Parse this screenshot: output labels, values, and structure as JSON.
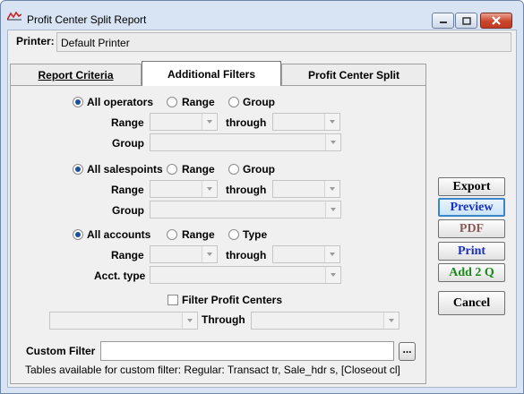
{
  "window": {
    "title": "Profit Center Split Report",
    "icon": "report-app-icon"
  },
  "printer": {
    "label": "Printer:",
    "value": "Default Printer"
  },
  "tabs": [
    {
      "label": "Report Criteria"
    },
    {
      "label": "Additional Filters"
    },
    {
      "label": "Profit Center Split"
    }
  ],
  "filters": {
    "operators": {
      "options": [
        "All operators",
        "Range",
        "Group"
      ],
      "selected": "All operators",
      "range_label": "Range",
      "through_label": "through",
      "group_label": "Group"
    },
    "salespoints": {
      "options": [
        "All salespoints",
        "Range",
        "Group"
      ],
      "selected": "All salespoints",
      "range_label": "Range",
      "through_label": "through",
      "group_label": "Group"
    },
    "accounts": {
      "options": [
        "All accounts",
        "Range",
        "Type"
      ],
      "selected": "All accounts",
      "range_label": "Range",
      "through_label": "through",
      "type_label": "Acct. type"
    },
    "profit_centers": {
      "checkbox_label": "Filter Profit Centers",
      "checked": false,
      "through_label": "Through"
    },
    "custom": {
      "label": "Custom Filter",
      "value": "",
      "browse_label": "...",
      "tables_note": "Tables available for custom filter: Regular: Transact tr, Sale_hdr s, [Closeout cl]"
    }
  },
  "actions": [
    {
      "label": "Export",
      "color": "#000000"
    },
    {
      "label": "Preview",
      "color": "#1a2fc4"
    },
    {
      "label": "PDF",
      "color": "#8b5a5a"
    },
    {
      "label": "Print",
      "color": "#1a2fc4"
    },
    {
      "label": "Add 2 Q",
      "color": "#1a8a1a"
    },
    {
      "label": "Cancel",
      "color": "#000000"
    }
  ]
}
